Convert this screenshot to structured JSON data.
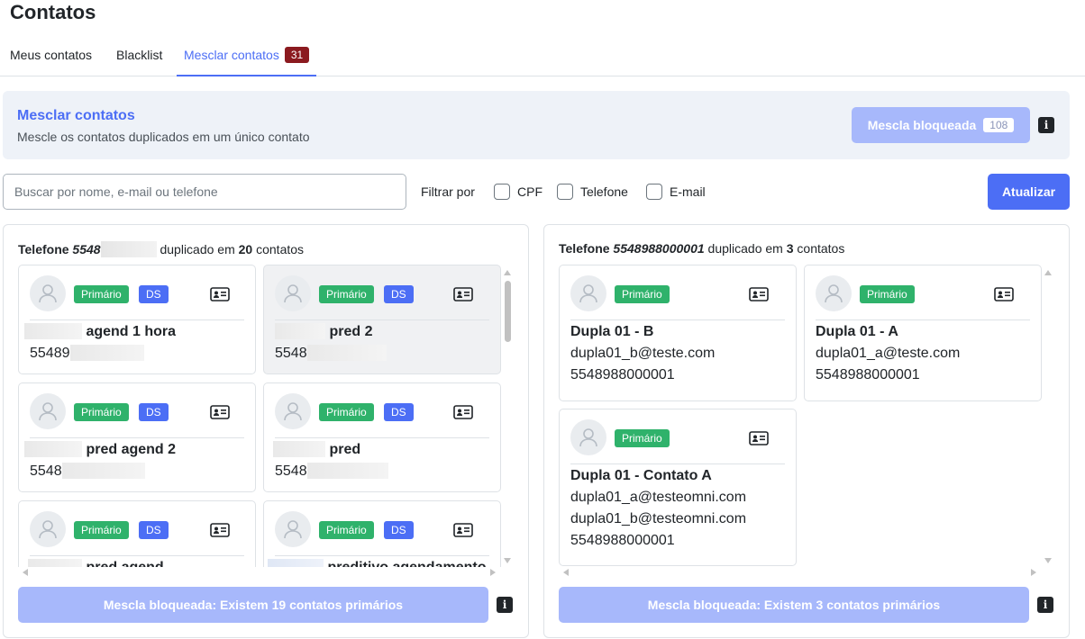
{
  "page": {
    "title": "Contatos"
  },
  "tabs": [
    {
      "label": "Meus contatos"
    },
    {
      "label": "Blacklist"
    },
    {
      "label": "Mesclar contatos",
      "badge": "31",
      "active": true
    }
  ],
  "banner": {
    "title": "Mesclar contatos",
    "subtitle": "Mescle os contatos duplicados em um único contato",
    "button_label": "Mescla bloqueada",
    "button_count": "108"
  },
  "search": {
    "placeholder": "Buscar por nome, e-mail ou telefone",
    "value": ""
  },
  "filters": {
    "label": "Filtrar por",
    "options": [
      {
        "label": "CPF",
        "checked": false
      },
      {
        "label": "Telefone",
        "checked": false
      },
      {
        "label": "E-mail",
        "checked": false
      }
    ]
  },
  "refresh_button": "Atualizar",
  "groups": [
    {
      "field": "Telefone",
      "value_prefix": "5548",
      "dup_text": "duplicado em",
      "count": "20",
      "count_suffix": "contatos",
      "contacts": [
        {
          "badge": "Primário",
          "tag": "DS",
          "name_suffix": "agend 1 hora",
          "phone_prefix": "55489"
        },
        {
          "badge": "Primário",
          "tag": "DS",
          "name_suffix": "pred 2",
          "phone_prefix": "5548"
        },
        {
          "badge": "Primário",
          "tag": "DS",
          "name_suffix": "pred agend 2",
          "phone_prefix": "5548"
        },
        {
          "badge": "Primário",
          "tag": "DS",
          "name_suffix": "pred",
          "phone_prefix": "5548"
        },
        {
          "badge": "Primário",
          "tag": "DS",
          "name_suffix": "pred agend",
          "phone_prefix": ""
        },
        {
          "badge": "Primário",
          "tag": "DS",
          "name_suffix": "preditivo agendamento",
          "phone_prefix": ""
        }
      ],
      "footer_button": "Mescla bloqueada: Existem 19 contatos primários"
    },
    {
      "field": "Telefone",
      "value": "5548988000001",
      "dup_text": "duplicado em",
      "count": "3",
      "count_suffix": "contatos",
      "contacts": [
        {
          "badge": "Primário",
          "name": "Dupla 01 - B",
          "lines": [
            "dupla01_b@teste.com",
            "5548988000001"
          ]
        },
        {
          "badge": "Primário",
          "name": "Dupla 01 - A",
          "lines": [
            "dupla01_a@teste.com",
            "5548988000001"
          ]
        },
        {
          "badge": "Primário",
          "name": "Dupla 01 - Contato A",
          "lines": [
            "dupla01_a@testeomni.com",
            "dupla01_b@testeomni.com",
            "5548988000001"
          ]
        }
      ],
      "footer_button": "Mescla bloqueada: Existem 3 contatos primários"
    }
  ],
  "icons": {
    "avatar": "user-avatar-icon",
    "card": "contact-card-icon",
    "info": "info-icon"
  },
  "colors": {
    "accent": "#4c6ef5",
    "primary_badge": "#2fb26b",
    "tab_badge": "#8b1a1f",
    "disabled_button": "#a7b8fb"
  }
}
